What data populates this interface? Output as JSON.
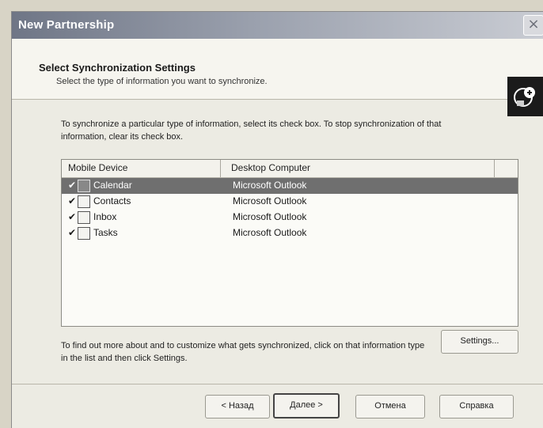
{
  "window": {
    "title": "New Partnership",
    "close_glyph": "×"
  },
  "header": {
    "title": "Select Synchronization Settings",
    "subtitle": "Select the type of information you want to synchronize.",
    "logo_icon": "sync-wizard-icon"
  },
  "instruction": "To synchronize a particular type of information, select its check box. To stop synchronization of that information, clear its check box.",
  "list": {
    "columns": [
      "Mobile Device",
      "Desktop Computer"
    ],
    "items": [
      {
        "label": "Calendar",
        "app": "Microsoft Outlook",
        "checked": true,
        "selected": true,
        "icon": "calendar-icon"
      },
      {
        "label": "Contacts",
        "app": "Microsoft Outlook",
        "checked": true,
        "selected": false,
        "icon": "contacts-icon"
      },
      {
        "label": "Inbox",
        "app": "Microsoft Outlook",
        "checked": true,
        "selected": false,
        "icon": "inbox-icon"
      },
      {
        "label": "Tasks",
        "app": "Microsoft Outlook",
        "checked": true,
        "selected": false,
        "icon": "tasks-icon"
      }
    ]
  },
  "footer_text": "To find out more about and to customize what gets synchronized, click on that information type in the list and then click Settings.",
  "buttons": {
    "settings": "Settings...",
    "back": "< Назад",
    "next": "Далее >",
    "cancel": "Отмена",
    "help": "Справка"
  },
  "check_glyph": "✔"
}
